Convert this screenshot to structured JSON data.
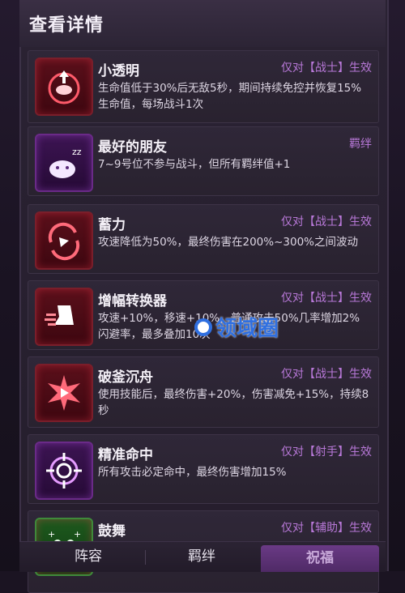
{
  "header": {
    "title": "查看详情"
  },
  "cards": [
    {
      "title": "小透明",
      "tag": "仅对【战士】生效",
      "desc": "生命值低于30%后无敌5秒，期间持续免控并恢复15%生命值，每场战斗1次",
      "icon": "shield-ward-icon",
      "color": "red"
    },
    {
      "title": "最好的朋友",
      "tag": "羁绊",
      "desc": "7~9号位不参与战斗，但所有羁绊值+1",
      "icon": "sleeping-pet-icon",
      "color": "purple"
    },
    {
      "title": "蓄力",
      "tag": "仅对【战士】生效",
      "desc": "攻速降低为50%，最终伤害在200%~300%之间波动",
      "icon": "charge-swirl-icon",
      "color": "red"
    },
    {
      "title": "增幅转换器",
      "tag": "仅对【战士】生效",
      "desc": "攻速+10%，移速+10%，普通攻击50%几率增加2%闪避率，最多叠加10次",
      "icon": "speed-boot-icon",
      "color": "red"
    },
    {
      "title": "破釜沉舟",
      "tag": "仅对【战士】生效",
      "desc": "使用技能后，最终伤害+20%，伤害减免+15%，持续8秒",
      "icon": "spiky-burst-icon",
      "color": "red"
    },
    {
      "title": "精准命中",
      "tag": "仅对【射手】生效",
      "desc": "所有攻击必定命中，最终伤害增加15%",
      "icon": "crosshair-icon",
      "color": "purple"
    },
    {
      "title": "鼓舞",
      "tag": "仅对【辅助】生效",
      "desc": "",
      "icon": "team-buff-icon",
      "color": "green"
    }
  ],
  "footer": {
    "tab1": "阵容",
    "tab2": "羁绊",
    "tab3": "祝福"
  },
  "watermark": "领域圈"
}
